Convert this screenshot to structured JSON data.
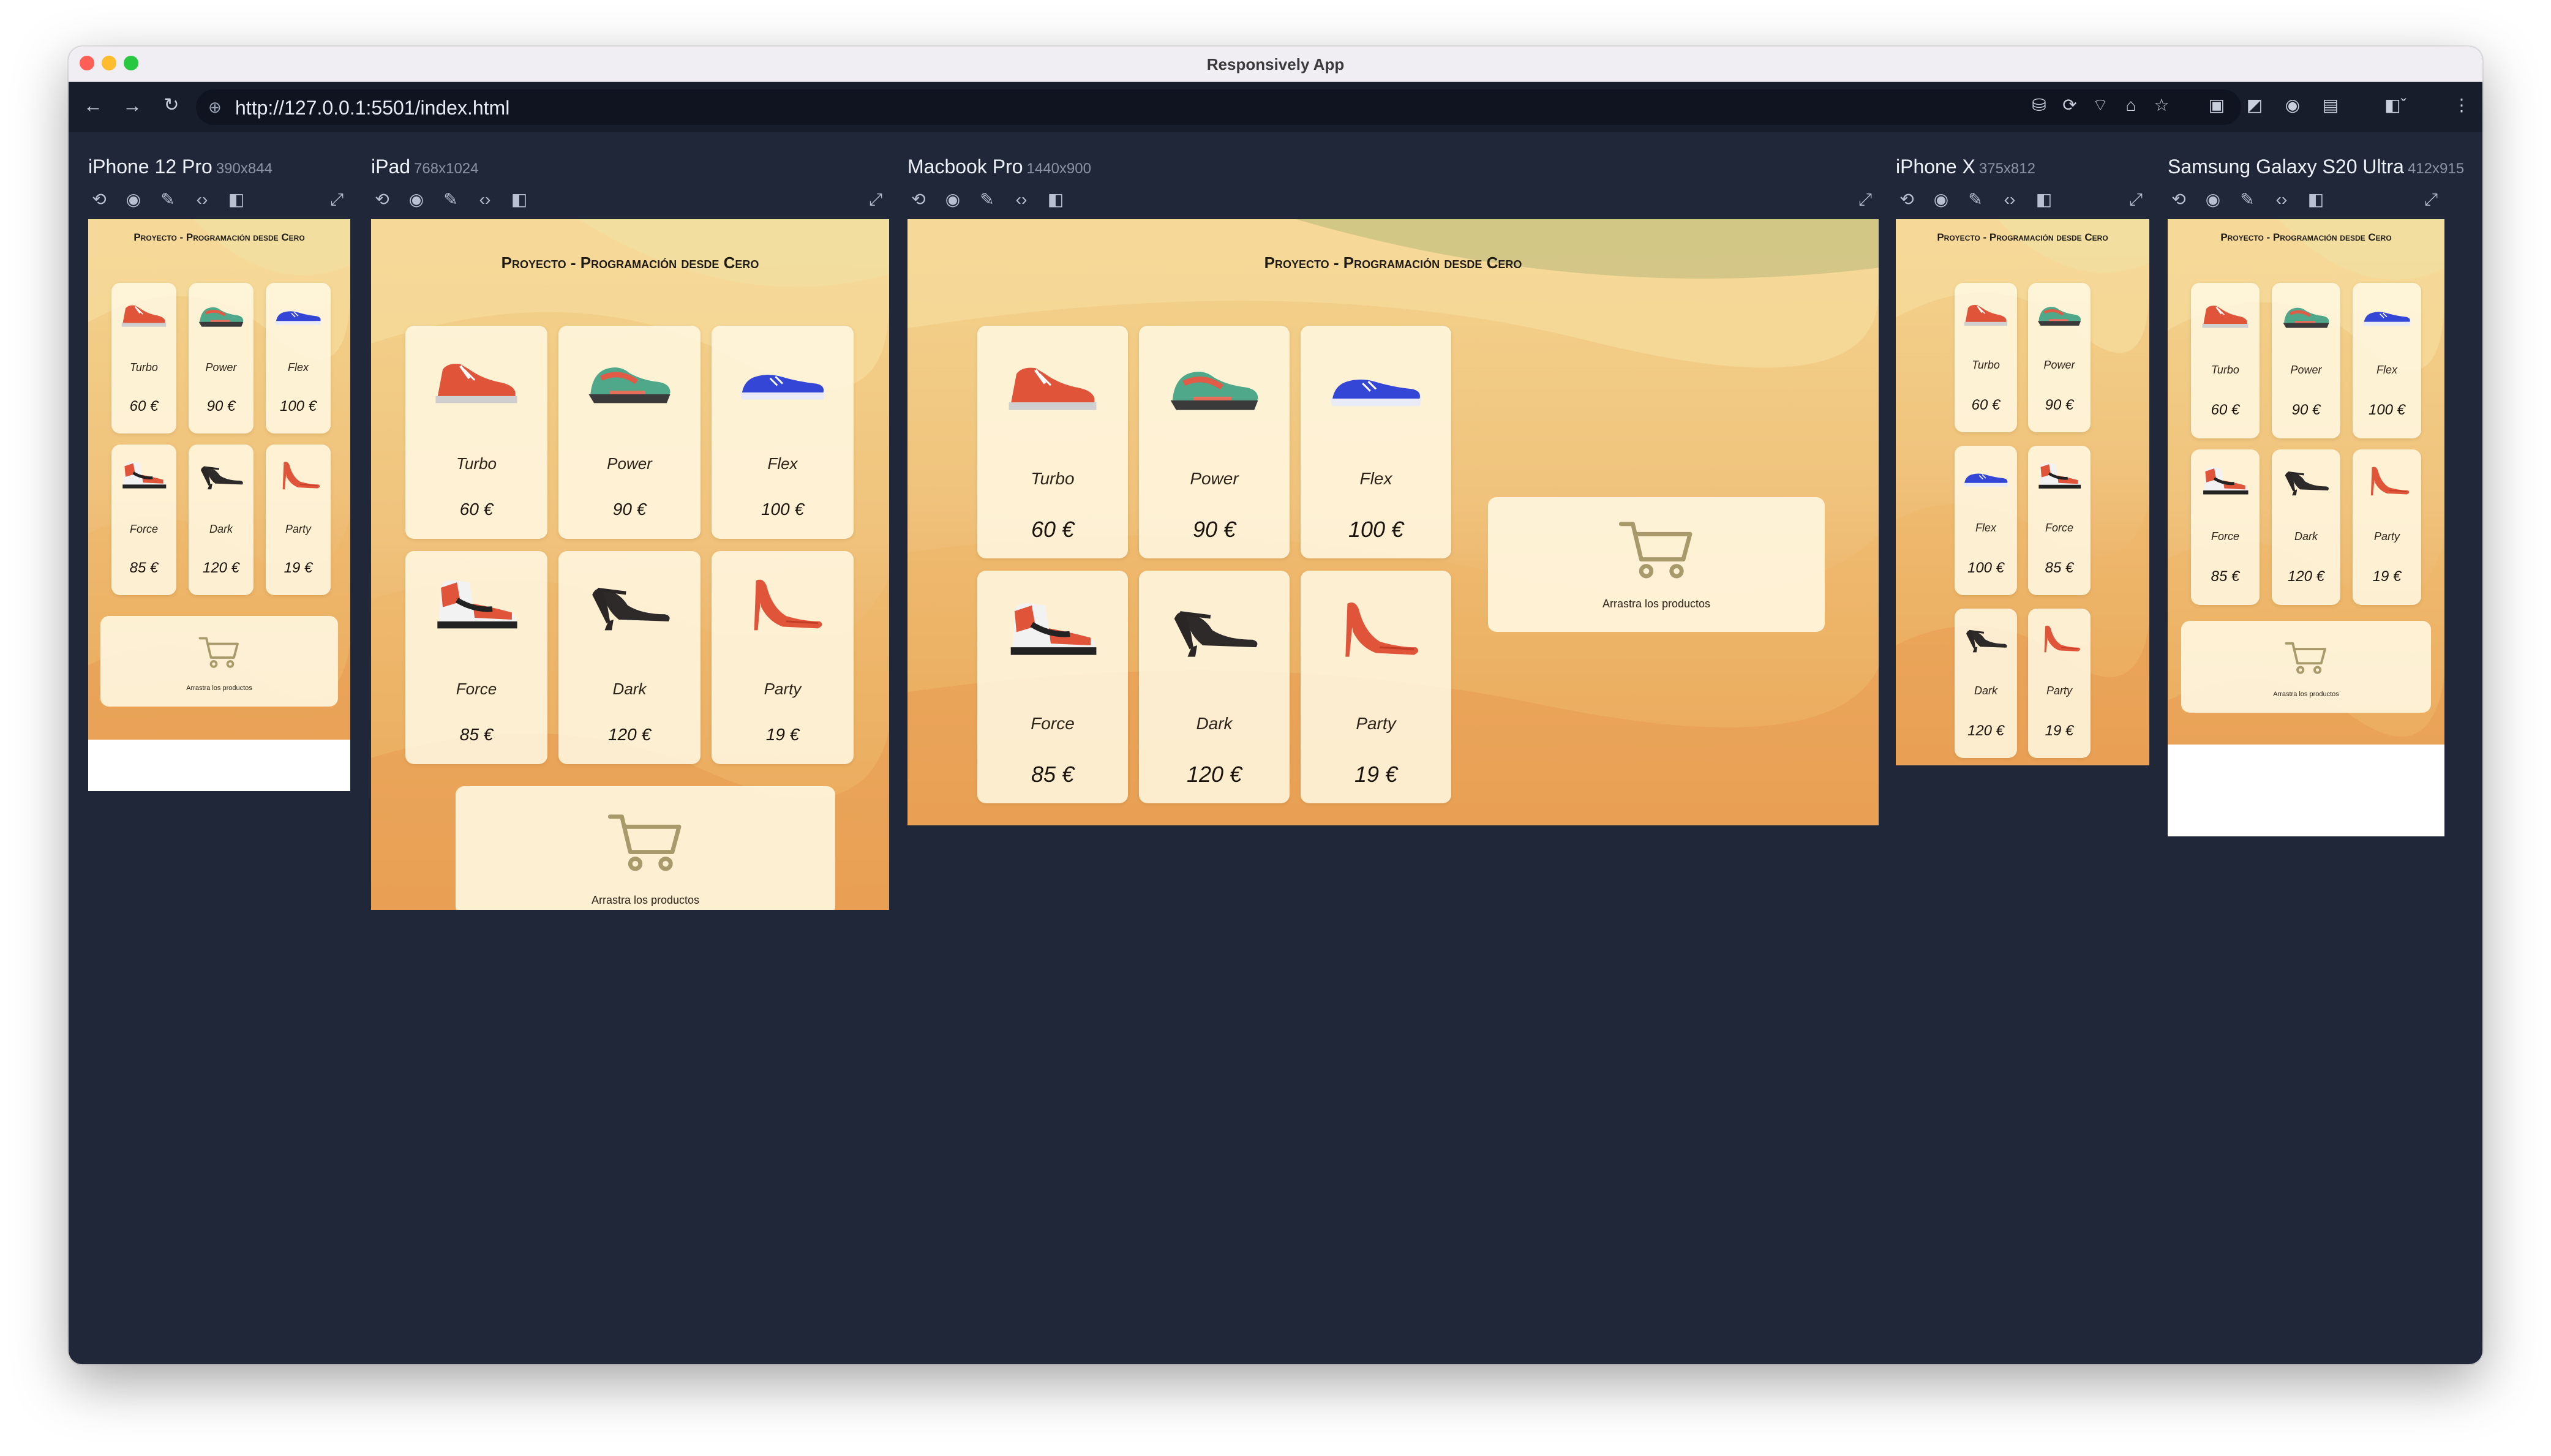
{
  "window": {
    "title": "Responsively App",
    "url": "http://127.0.0.1:5501/index.html"
  },
  "colors": {
    "chrome_bg": "#1f2739",
    "accent_cart": "#a89a6a",
    "light_red": "#ff5f57",
    "light_yellow": "#febc2e",
    "light_green": "#28c840"
  },
  "page": {
    "title": "Proyecto - Programación desde Cero",
    "cart_text": "Arrastra los productos",
    "currency": "€",
    "products": [
      {
        "name": "Turbo",
        "price": "60",
        "icon": "red-sneaker"
      },
      {
        "name": "Power",
        "price": "90",
        "icon": "green-running-shoe"
      },
      {
        "name": "Flex",
        "price": "100",
        "icon": "blue-sneaker"
      },
      {
        "name": "Force",
        "price": "85",
        "icon": "high-top-sneaker"
      },
      {
        "name": "Dark",
        "price": "120",
        "icon": "black-heel"
      },
      {
        "name": "Party",
        "price": "19",
        "icon": "red-stiletto"
      }
    ]
  },
  "devices": [
    {
      "name": "iPhone 12 Pro",
      "res": "390x844"
    },
    {
      "name": "iPad",
      "res": "768x1024"
    },
    {
      "name": "Macbook Pro",
      "res": "1440x900"
    },
    {
      "name": "iPhone X",
      "res": "375x812"
    },
    {
      "name": "Samsung Galaxy S20 Ultra",
      "res": "412x915"
    }
  ]
}
